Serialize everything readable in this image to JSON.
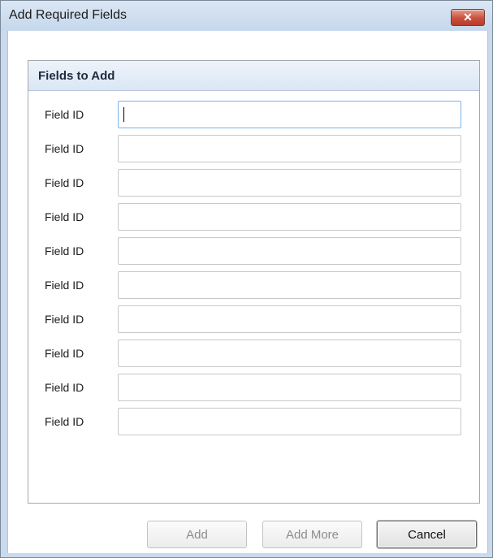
{
  "window": {
    "title": "Add Required Fields",
    "close_glyph": "✕"
  },
  "panel": {
    "header": "Fields to Add",
    "fields": [
      {
        "label": "Field ID",
        "value": ""
      },
      {
        "label": "Field ID",
        "value": ""
      },
      {
        "label": "Field ID",
        "value": ""
      },
      {
        "label": "Field ID",
        "value": ""
      },
      {
        "label": "Field ID",
        "value": ""
      },
      {
        "label": "Field ID",
        "value": ""
      },
      {
        "label": "Field ID",
        "value": ""
      },
      {
        "label": "Field ID",
        "value": ""
      },
      {
        "label": "Field ID",
        "value": ""
      },
      {
        "label": "Field ID",
        "value": ""
      }
    ]
  },
  "buttons": {
    "add": "Add",
    "add_more": "Add More",
    "cancel": "Cancel"
  },
  "colors": {
    "titlebar": "#c9daed",
    "close_button": "#c8503d",
    "panel_header": "#dbe6f5"
  }
}
